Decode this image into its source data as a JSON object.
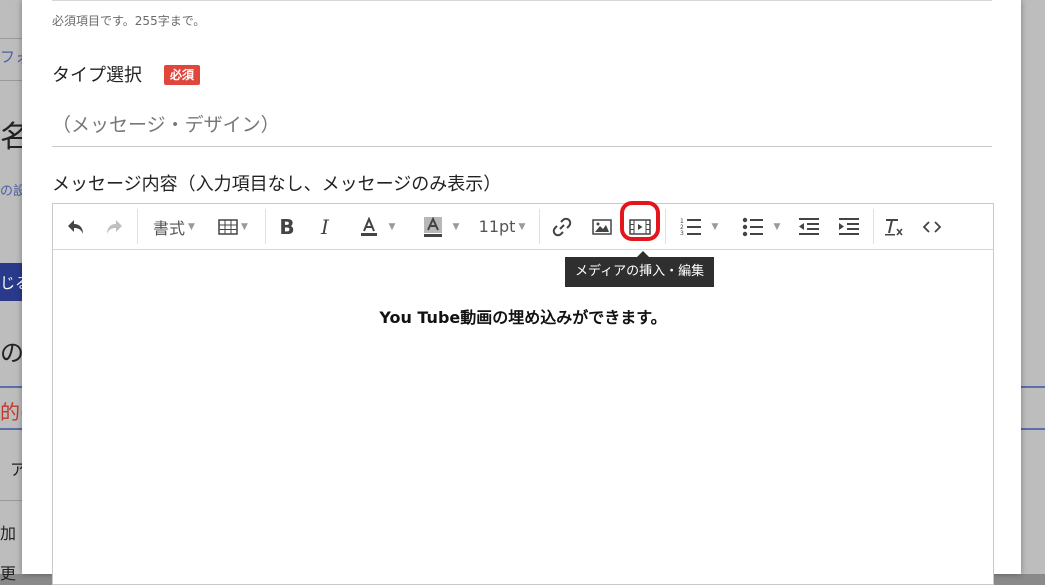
{
  "background_page": {
    "fragments": [
      "フォ",
      "名",
      "の設",
      "じる",
      "の",
      "的の",
      "ア",
      "加",
      "更"
    ]
  },
  "modal": {
    "name_field_help": "必須項目です。255字まで。",
    "type_select": {
      "label": "タイプ選択",
      "required_badge": "必須",
      "value": "（メッセージ・デザイン）"
    },
    "message_content": {
      "label": "メッセージ内容（入力項目なし、メッセージのみ表示）",
      "toolbar": {
        "format_label": "書式",
        "font_size_label": "11pt",
        "tooltip": "メディアの挿入・編集"
      },
      "body_text": "You Tube動画の埋め込みができます。"
    }
  },
  "colors": {
    "badge": "#e0463c",
    "highlight": "#e5161b",
    "tooltip_bg": "#2f2f2f"
  },
  "icons": [
    "undo-icon",
    "redo-icon",
    "table-icon",
    "bold-icon",
    "italic-icon",
    "text-color-icon",
    "background-color-icon",
    "link-icon",
    "image-icon",
    "media-icon",
    "numbered-list-icon",
    "bullet-list-icon",
    "outdent-icon",
    "indent-icon",
    "clear-format-icon",
    "source-code-icon"
  ]
}
